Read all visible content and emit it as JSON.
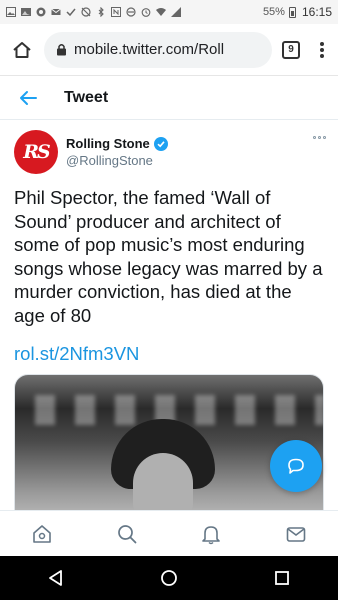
{
  "status_bar": {
    "icons": [
      "image-icon",
      "gallery-icon",
      "chat-icon",
      "mail-icon",
      "check-icon",
      "no-sync-icon",
      "bluetooth-icon",
      "nfc-icon",
      "mute-icon",
      "alarm-icon",
      "wifi-icon",
      "signal-icon"
    ],
    "battery": "55%",
    "time": "16:15"
  },
  "browser": {
    "url": "mobile.twitter.com/Roll",
    "tab_count": "9"
  },
  "header": {
    "title": "Tweet"
  },
  "tweet": {
    "author_name": "Rolling Stone",
    "author_handle": "@RollingStone",
    "avatar_text": "RS",
    "text": "Phil Spector, the famed ‘Wall of Sound’ producer and architect of some of pop music’s most enduring songs whose legacy was marred by a murder conviction, has died at the age of 80",
    "link": "rol.st/2Nfm3VN"
  },
  "colors": {
    "accent": "#1da1f2",
    "link": "#1b95e0",
    "avatar_bg": "#d71920"
  },
  "bottom_nav": [
    "home-icon",
    "search-icon",
    "notifications-icon",
    "messages-icon"
  ],
  "android_nav": [
    "back-triangle-icon",
    "home-circle-icon",
    "recents-square-icon"
  ]
}
